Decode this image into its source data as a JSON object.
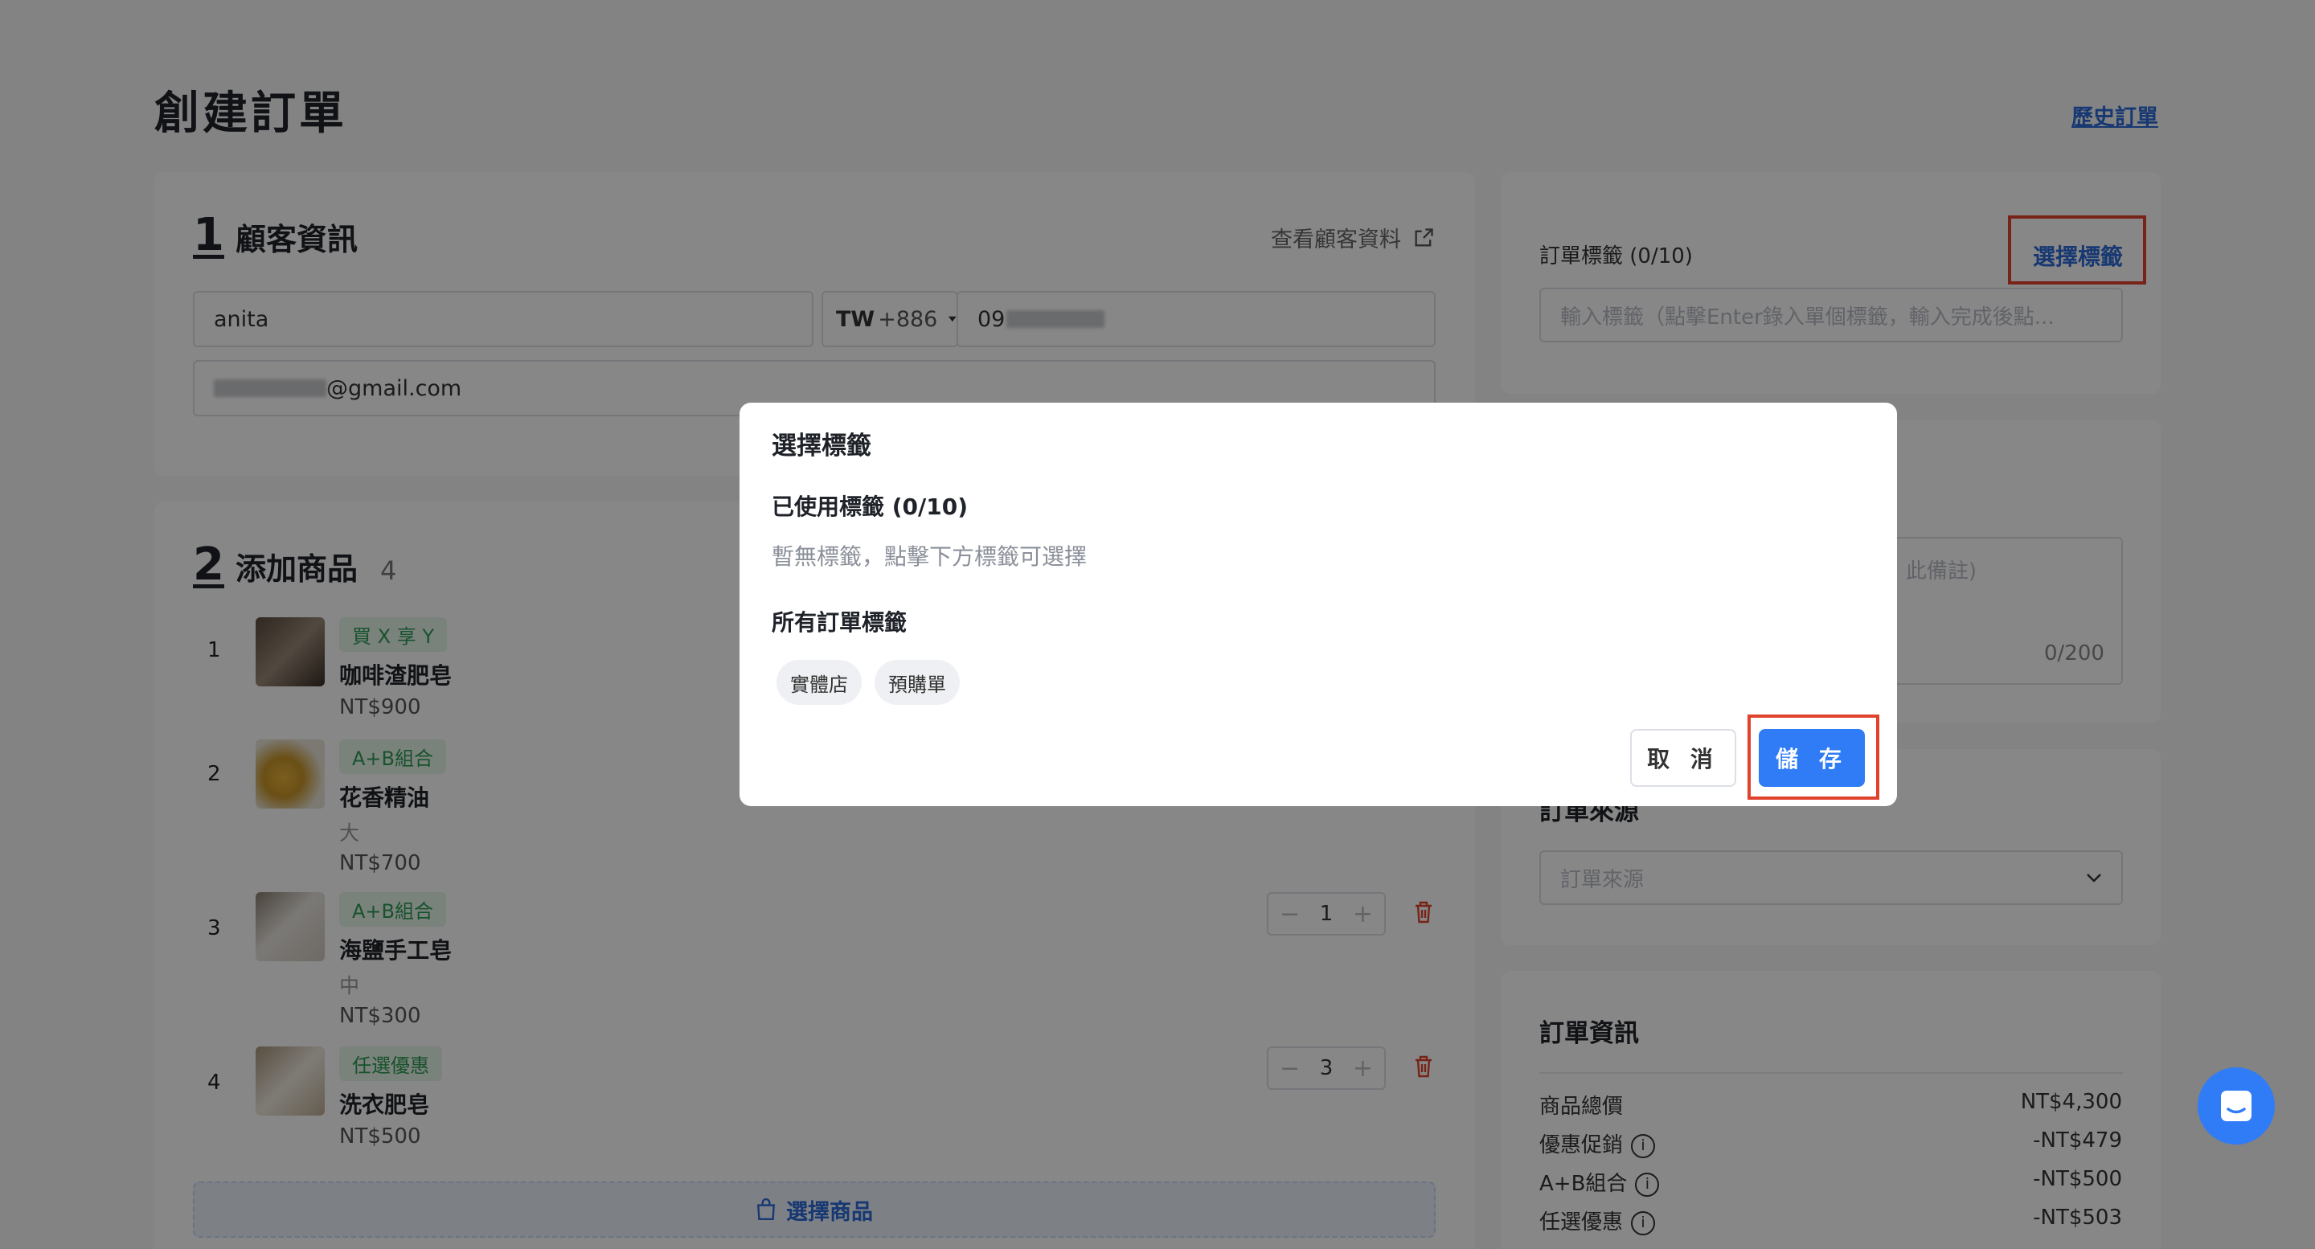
{
  "page": {
    "title": "創建訂單",
    "history_link": "歷史訂單"
  },
  "customer": {
    "step": "1",
    "title": "顧客資訊",
    "view_link": "查看顧客資料",
    "name_value": "anita",
    "country_code": "TW",
    "dial_code": "+886",
    "phone_prefix": "09",
    "email_suffix": "@gmail.com"
  },
  "products": {
    "step": "2",
    "title": "添加商品",
    "count": "4",
    "items": [
      {
        "index": "1",
        "promo": "買 X 享 Y",
        "name": "咖啡渣肥皂",
        "variant": "",
        "price": "NT$900",
        "qty": ""
      },
      {
        "index": "2",
        "promo": "A+B組合",
        "name": "花香精油",
        "variant": "大",
        "price": "NT$700",
        "qty": ""
      },
      {
        "index": "3",
        "promo": "A+B組合",
        "name": "海鹽手工皂",
        "variant": "中",
        "price": "NT$300",
        "qty": "1"
      },
      {
        "index": "4",
        "promo": "任選優惠",
        "name": "洗衣肥皂",
        "variant": "",
        "price": "NT$500",
        "qty": "3"
      }
    ],
    "select_button": "選擇商品"
  },
  "order_tags": {
    "label": "訂單標籤 (0/10)",
    "select_link": "選擇標籤",
    "input_placeholder": "輸入標籤（點擊Enter錄入單個標籤，輸入完成後點..."
  },
  "remarks": {
    "placeholder_tail": "此備註)",
    "counter": "0/200"
  },
  "order_source": {
    "title": "訂單來源",
    "select_placeholder": "訂單來源"
  },
  "order_info": {
    "title": "訂單資訊",
    "rows": [
      {
        "label": "商品總價",
        "value": "NT$4,300",
        "info": false
      },
      {
        "label": "優惠促銷",
        "value": "-NT$479",
        "info": true
      },
      {
        "label": "A+B組合",
        "value": "-NT$500",
        "info": true
      },
      {
        "label": "任選優惠",
        "value": "-NT$503",
        "info": true
      }
    ]
  },
  "modal": {
    "title": "選擇標籤",
    "used_label": "已使用標籤 (0/10)",
    "empty_hint": "暫無標籤，點擊下方標籤可選擇",
    "all_label": "所有訂單標籤",
    "tags": [
      "實體店",
      "預購單"
    ],
    "cancel": "取 消",
    "save": "儲 存"
  },
  "colors": {
    "accent": "#2f7cf6",
    "highlight": "#e0422c",
    "promo_green": "#2f9b54"
  }
}
